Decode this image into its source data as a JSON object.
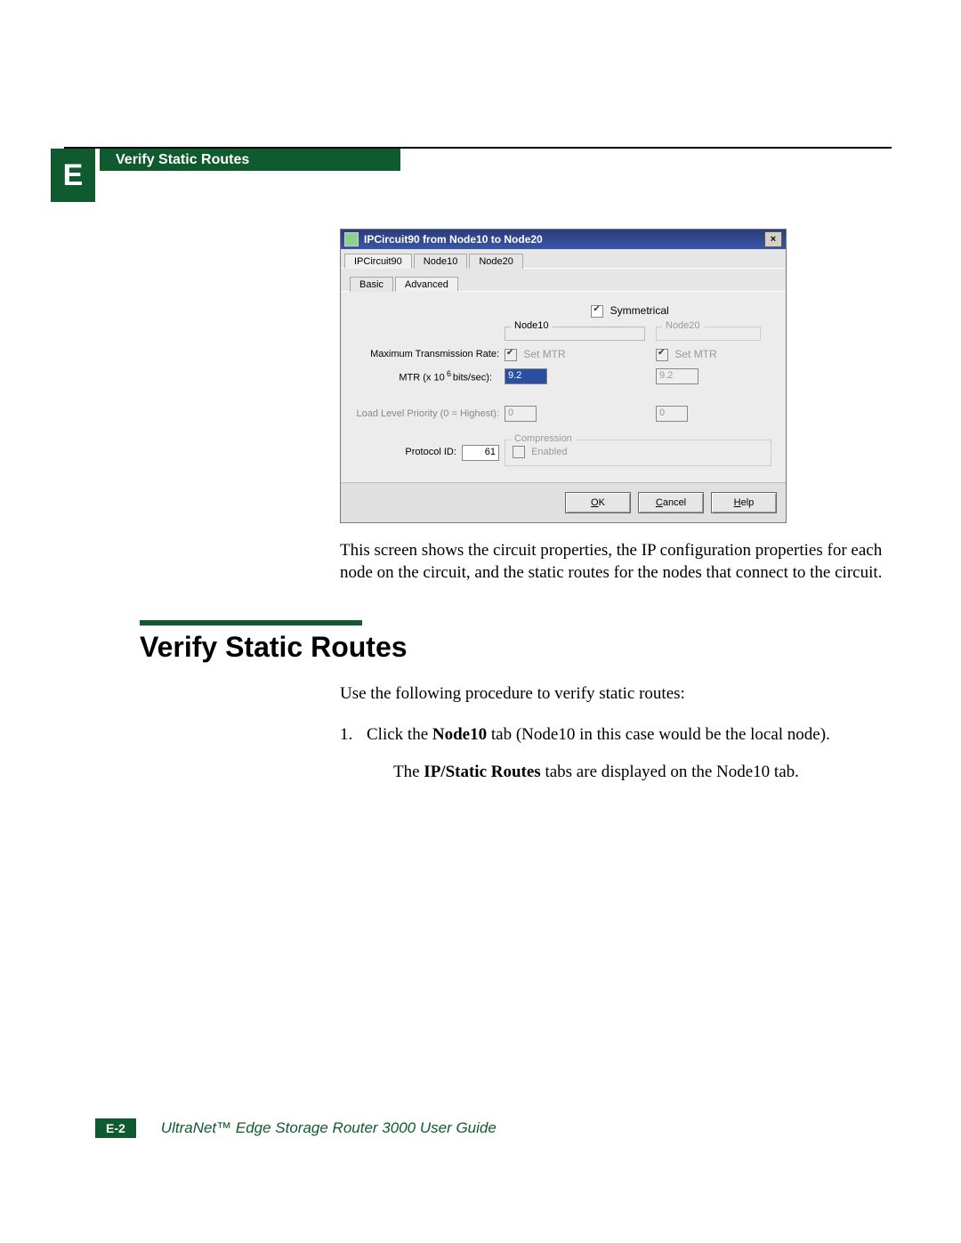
{
  "header": {
    "appendix_letter": "E",
    "tab_title": "Verify Static Routes"
  },
  "dialog": {
    "title": "IPCircuit90 from Node10 to Node20",
    "close_glyph": "×",
    "tabs_top": [
      "IPCircuit90",
      "Node10",
      "Node20"
    ],
    "tabs_inner": [
      "Basic",
      "Advanced"
    ],
    "symmetrical_label": "Symmetrical",
    "row_labels": {
      "mtr_rate": "Maximum Transmission Rate:",
      "mtr_bits": "MTR (x 10   bits/sec):",
      "mtr_bits_exp": "6",
      "load_priority": "Load Level Priority (0 = Highest):",
      "protocol_id": "Protocol ID:"
    },
    "groups": {
      "node10_legend": "Node10",
      "node20_legend": "Node20",
      "set_mtr_label": "Set MTR",
      "compression_legend": "Compression",
      "compression_enabled_label": "Enabled"
    },
    "values": {
      "node10_mtr": "9.2",
      "node20_mtr": "9.2",
      "node10_priority": "0",
      "node20_priority": "0",
      "protocol_id": "61"
    },
    "buttons": {
      "ok": "OK",
      "cancel": "Cancel",
      "help": "Help"
    }
  },
  "caption_paragraph": "This screen shows the circuit properties, the IP configuration properties for each node on the circuit, and the static routes for the nodes that connect to the circuit.",
  "section": {
    "heading": "Verify Static Routes",
    "intro": "Use the following procedure to verify static routes:",
    "step1_num": "1.",
    "step1_a": "Click the ",
    "step1_bold": "Node10",
    "step1_b": " tab (Node10 in this case would be the local node).",
    "step1_after_a": "The ",
    "step1_after_bold": "IP/Static Routes",
    "step1_after_b": " tabs are displayed on the Node10 tab."
  },
  "footer": {
    "page_badge": "E-2",
    "book_title": "UltraNet™ Edge Storage Router 3000 User Guide"
  }
}
